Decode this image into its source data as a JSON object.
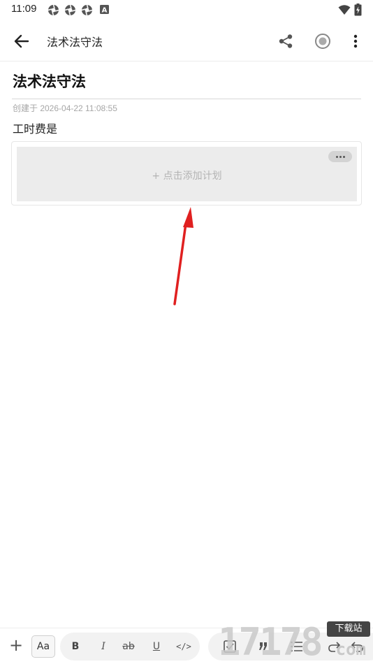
{
  "status_bar": {
    "time": "11:09",
    "notification_icons": [
      "aperture-icon",
      "aperture-icon",
      "aperture-icon",
      "a-letter-icon"
    ],
    "right_icons": [
      "wifi-icon",
      "battery-charging-icon"
    ]
  },
  "toolbar": {
    "title": "法术法守法",
    "back_icon": "arrow-left-icon",
    "share_icon": "share-icon",
    "record_icon": "record-icon",
    "more_icon": "more-vert-icon"
  },
  "note": {
    "title": "法术法守法",
    "created_label": "创建于 2026-04-22 11:08:55",
    "body": "工时费是"
  },
  "plan_card": {
    "add_label": "+ 点击添加计划",
    "more_icon": "more-horiz-icon"
  },
  "bottom_toolbar": {
    "add_icon": "+",
    "font_button": "Aa",
    "format_buttons": [
      "B",
      "I",
      "ab",
      "U",
      "</>"
    ],
    "extra_icons": [
      "checkbox-icon",
      "quote-icon",
      "list-icon",
      "redo-icon",
      "undo-icon"
    ]
  },
  "watermark": {
    "digits": "17178",
    "badge": "下载站",
    "suffix": "com"
  },
  "colors": {
    "annotation_arrow": "#e02020",
    "plan_background": "#ececec",
    "muted_text": "#a6a6a6"
  }
}
